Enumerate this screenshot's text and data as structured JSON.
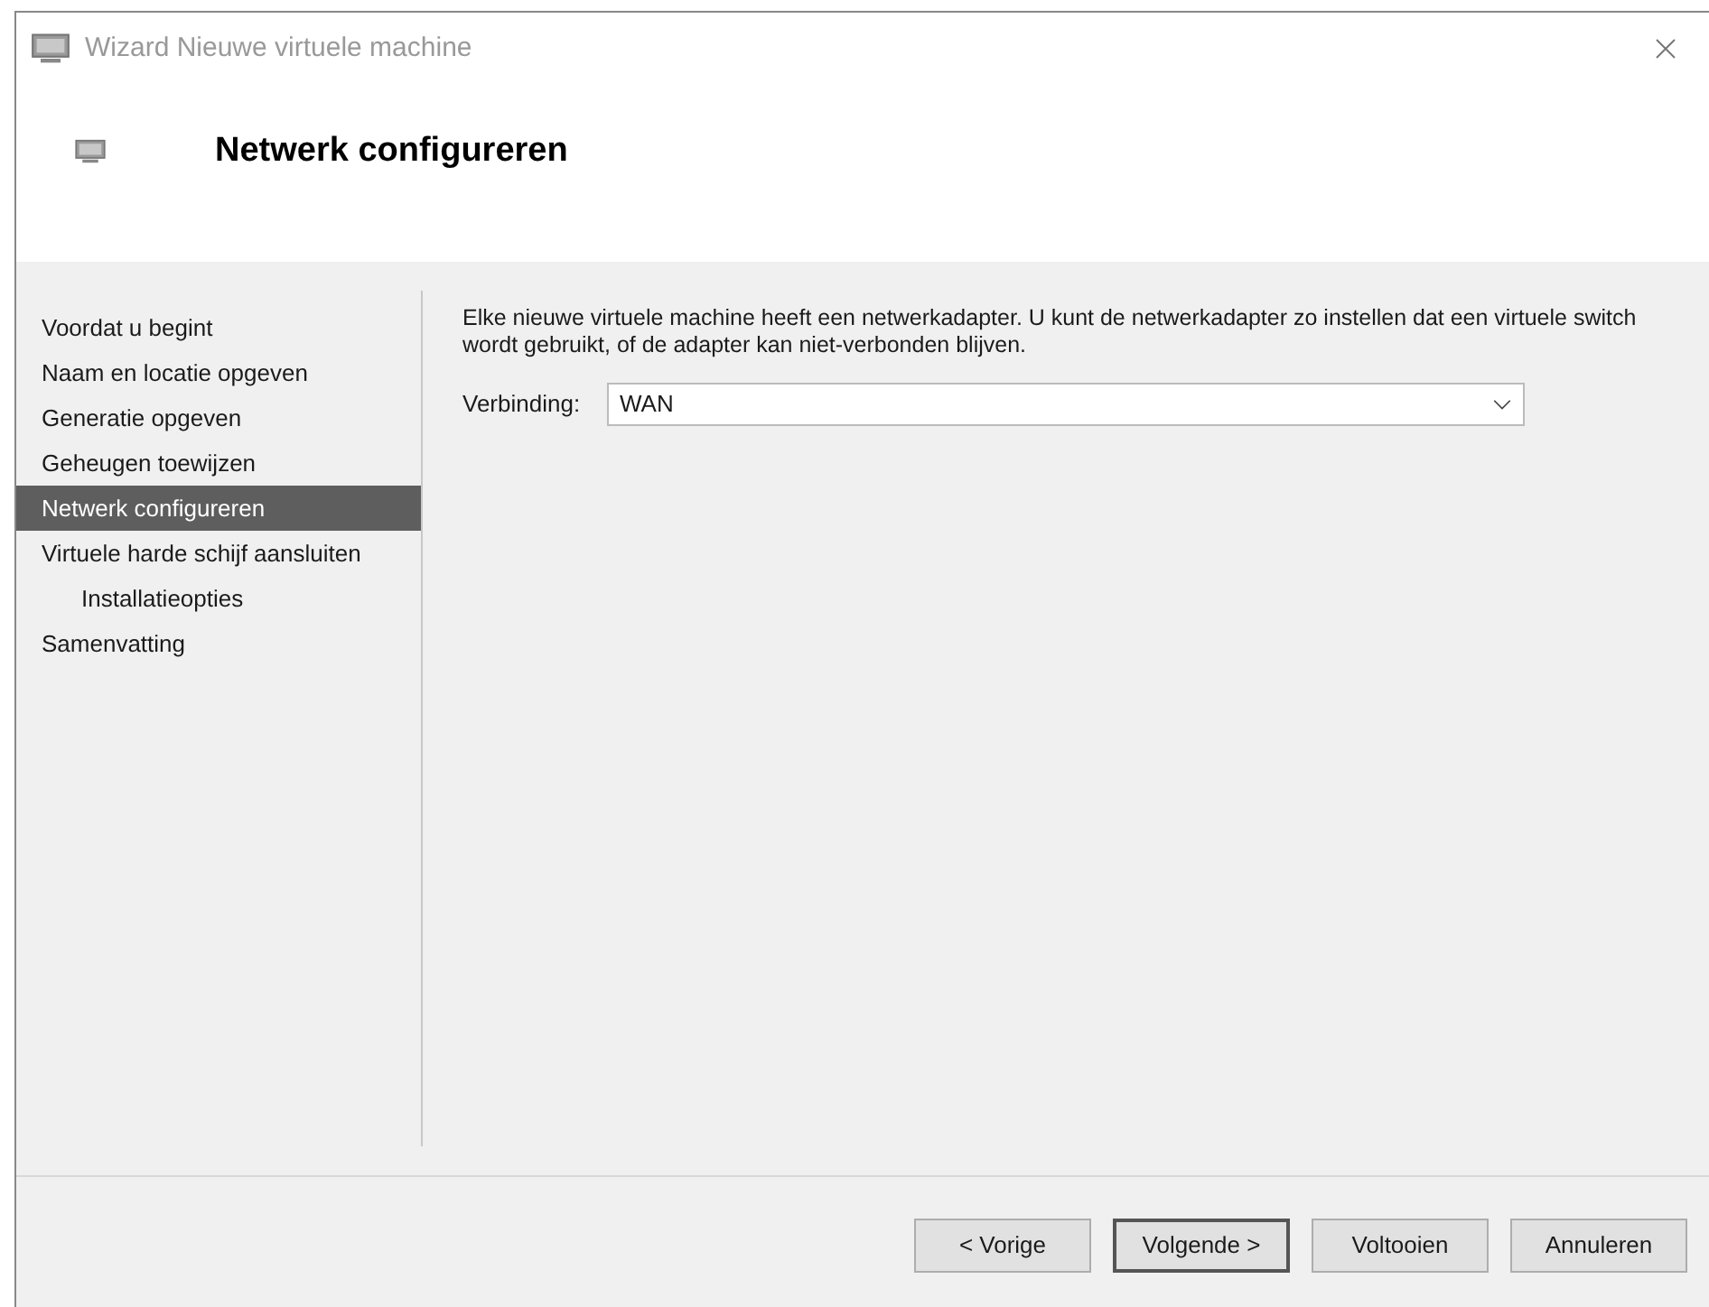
{
  "window": {
    "title": "Wizard Nieuwe virtuele machine"
  },
  "header": {
    "title": "Netwerk configureren"
  },
  "steps": [
    {
      "label": "Voordat u begint",
      "selected": false
    },
    {
      "label": "Naam en locatie opgeven",
      "selected": false
    },
    {
      "label": "Generatie opgeven",
      "selected": false
    },
    {
      "label": "Geheugen toewijzen",
      "selected": false
    },
    {
      "label": "Netwerk configureren",
      "selected": true
    },
    {
      "label": "Virtuele harde schijf aansluiten",
      "selected": false,
      "children": [
        {
          "label": "Installatieopties",
          "selected": false
        }
      ]
    },
    {
      "label": "Samenvatting",
      "selected": false
    }
  ],
  "description": "Elke nieuwe virtuele machine heeft een netwerkadapter. U kunt de netwerkadapter zo instellen dat een virtuele switch wordt gebruikt, of de adapter kan niet-verbonden blijven.",
  "connection": {
    "label": "Verbinding:",
    "value": "WAN"
  },
  "buttons": [
    {
      "label": "< Vorige",
      "default": false
    },
    {
      "label": "Volgende >",
      "default": true
    },
    {
      "label": "Voltooien",
      "default": false
    },
    {
      "label": "Annuleren",
      "default": false
    }
  ]
}
